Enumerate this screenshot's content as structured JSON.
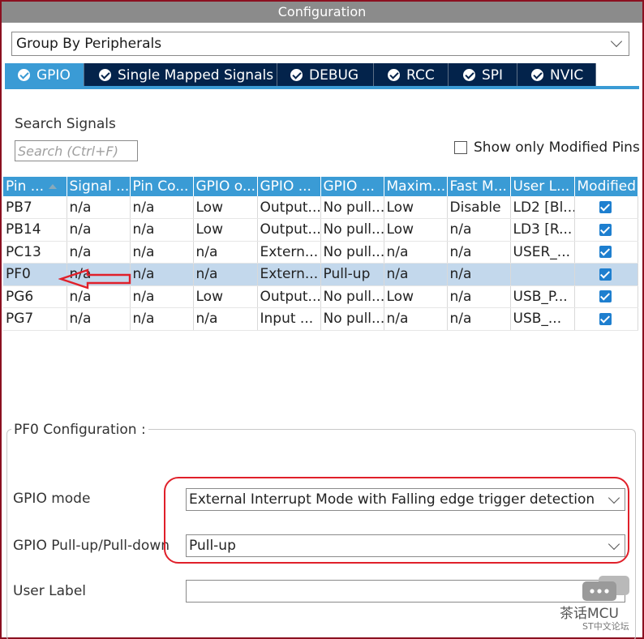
{
  "window": {
    "title": "Configuration"
  },
  "group_select": {
    "value": "Group By Peripherals"
  },
  "tabs": [
    {
      "label": "GPIO",
      "active": true
    },
    {
      "label": "Single Mapped Signals",
      "active": false
    },
    {
      "label": "DEBUG",
      "active": false
    },
    {
      "label": "RCC",
      "active": false
    },
    {
      "label": "SPI",
      "active": false
    },
    {
      "label": "NVIC",
      "active": false
    }
  ],
  "search": {
    "label": "Search Signals",
    "placeholder": "Search (Ctrl+F)"
  },
  "show_modified": {
    "label": "Show only Modified Pins",
    "checked": false
  },
  "table": {
    "headers": [
      "Pin ...",
      "Signal ...",
      "Pin Co...",
      "GPIO o...",
      "GPIO ...",
      "GPIO ...",
      "Maxim...",
      "Fast M...",
      "User L...",
      "Modified"
    ],
    "rows": [
      [
        "PB7",
        "n/a",
        "n/a",
        "Low",
        "Output...",
        "No pull...",
        "Low",
        "Disable",
        "LD2 [Bl...",
        true
      ],
      [
        "PB14",
        "n/a",
        "n/a",
        "Low",
        "Output...",
        "No pull...",
        "Low",
        "n/a",
        "LD3 [R...",
        true
      ],
      [
        "PC13",
        "n/a",
        "n/a",
        "n/a",
        "Extern...",
        "No pull...",
        "n/a",
        "n/a",
        "USER_...",
        true
      ],
      [
        "PF0",
        "n/a",
        "n/a",
        "n/a",
        "Extern...",
        "Pull-up",
        "n/a",
        "n/a",
        "",
        true
      ],
      [
        "PG6",
        "n/a",
        "n/a",
        "Low",
        "Output...",
        "No pull...",
        "Low",
        "n/a",
        "USB_P...",
        true
      ],
      [
        "PG7",
        "n/a",
        "n/a",
        "n/a",
        "Input ...",
        "No pull...",
        "n/a",
        "n/a",
        "USB_...",
        true
      ]
    ],
    "selected_row": 3
  },
  "config": {
    "title": "PF0 Configuration :",
    "gpio_mode": {
      "label": "GPIO mode",
      "value": "External Interrupt Mode with Falling edge trigger detection"
    },
    "pull": {
      "label": "GPIO Pull-up/Pull-down",
      "value": "Pull-up"
    },
    "user_label": {
      "label": "User Label",
      "value": ""
    }
  },
  "watermark": {
    "text": "茶话MCU",
    "sub": "ST中文论坛",
    "icon": "chat-bubble-icon"
  },
  "colors": {
    "accent": "#3a9bd5",
    "tab_bg": "#03234b",
    "highlight": "#e0202a",
    "frame": "#8b1020"
  }
}
